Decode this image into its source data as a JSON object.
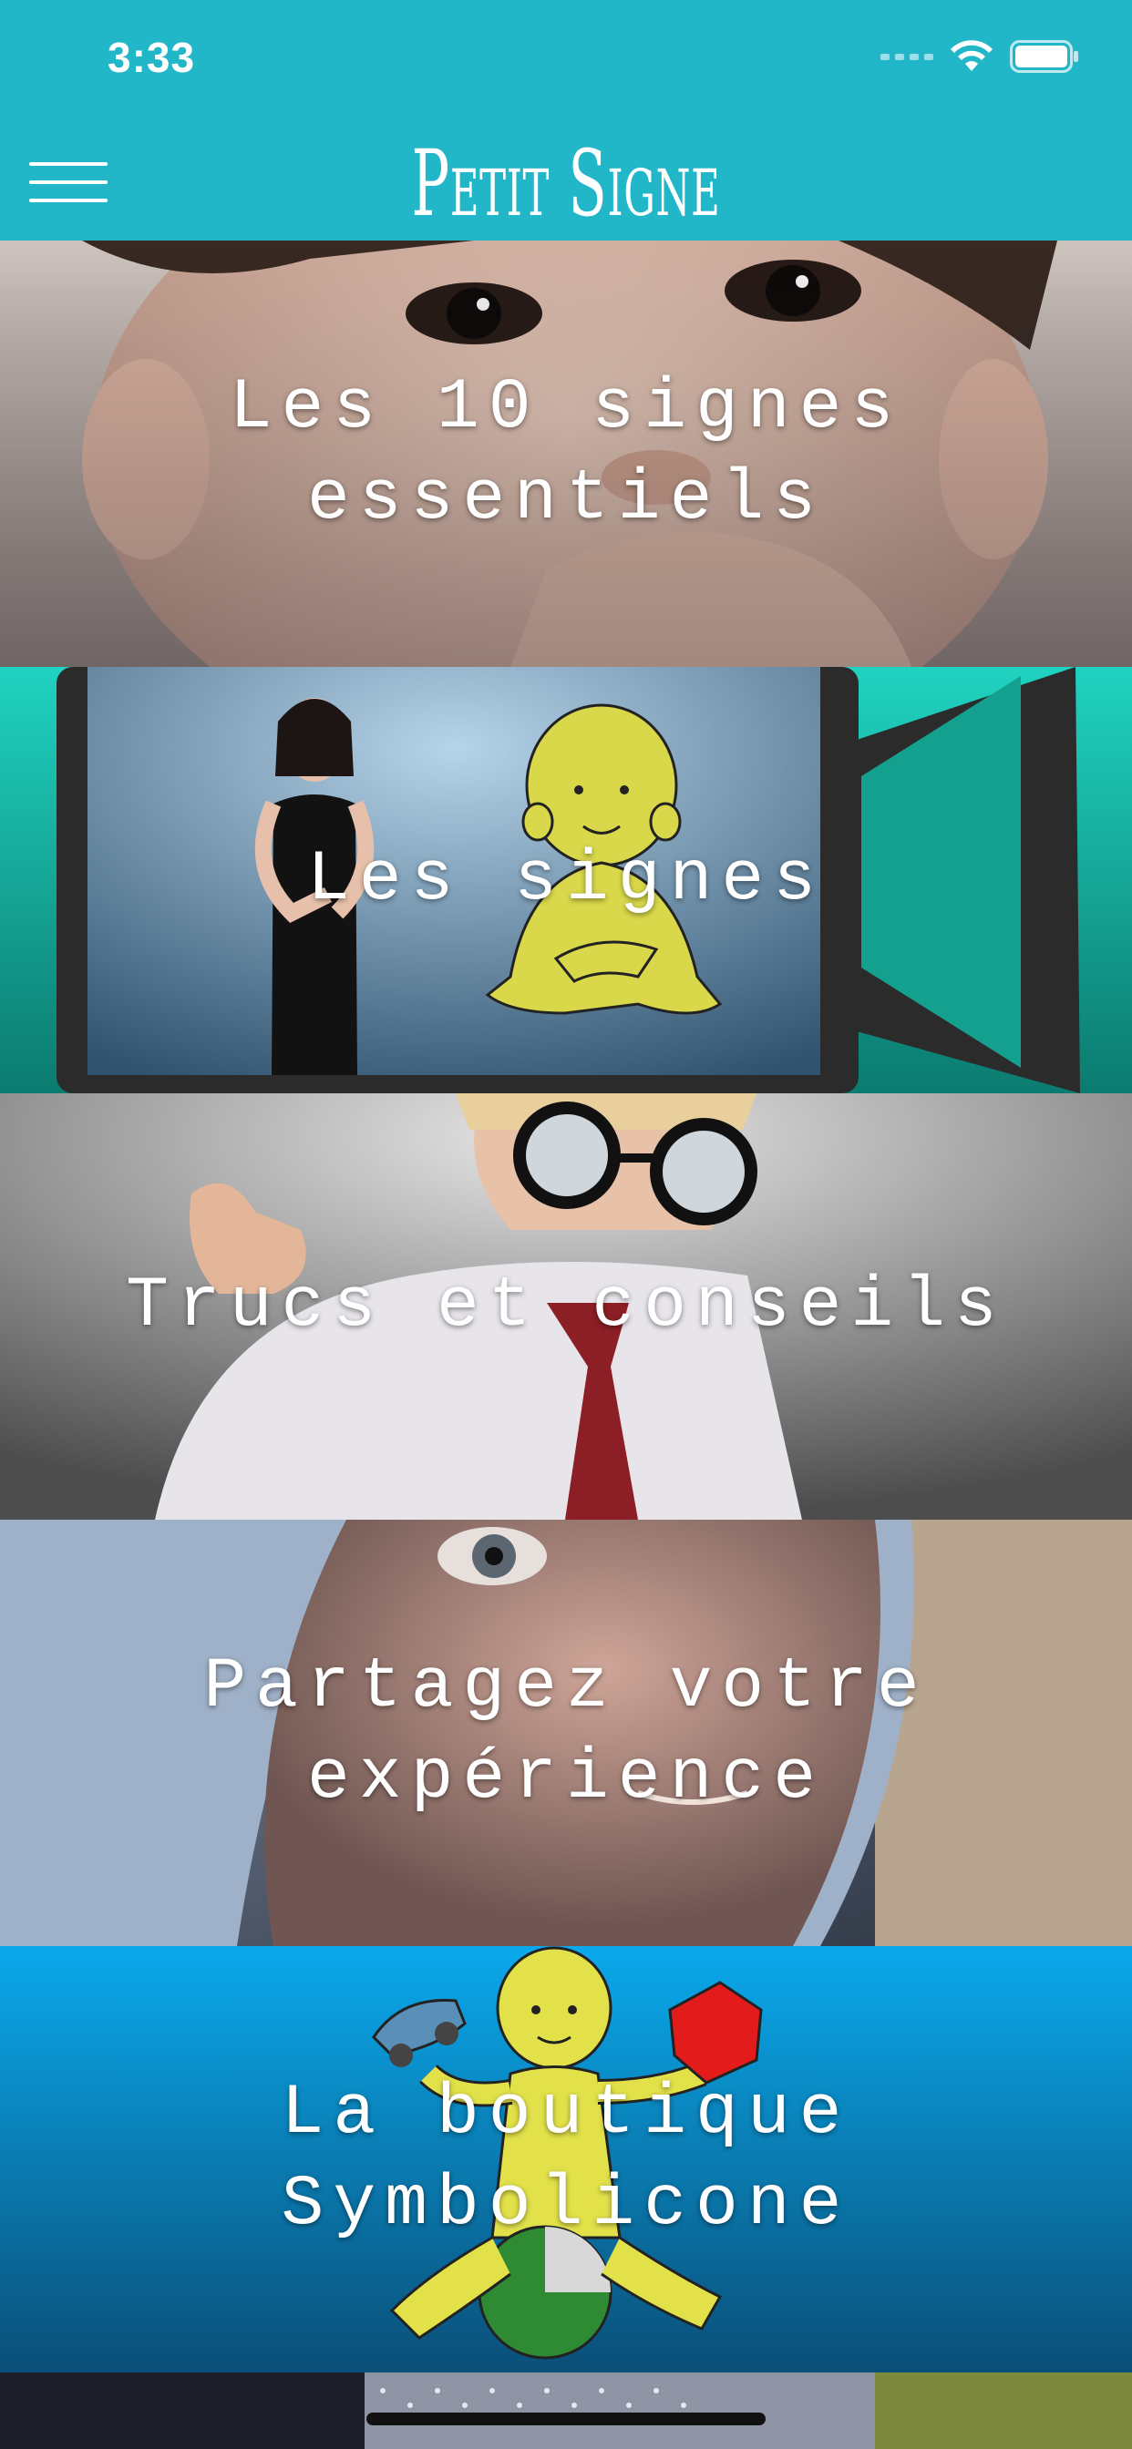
{
  "status_bar": {
    "time": "3:33"
  },
  "nav": {
    "title": "Petit Signe",
    "menu_icon": "hamburger-menu-icon"
  },
  "tiles": [
    {
      "label": "Les 10 signes\nessentiels",
      "image": "baby-face-photo"
    },
    {
      "label": "Les signes",
      "image": "sign-video-illustration"
    },
    {
      "label": "Trucs et conseils",
      "image": "child-with-glasses-photo"
    },
    {
      "label": "Partagez votre\nexpérience",
      "image": "baby-in-hood-photo"
    },
    {
      "label": "La boutique\nSymbolicone",
      "image": "symbolicone-character-illustration"
    }
  ],
  "colors": {
    "header": "#22b6c9",
    "teal_accent": "#1fb7a4",
    "shop_blue": "#0aa6e6"
  }
}
